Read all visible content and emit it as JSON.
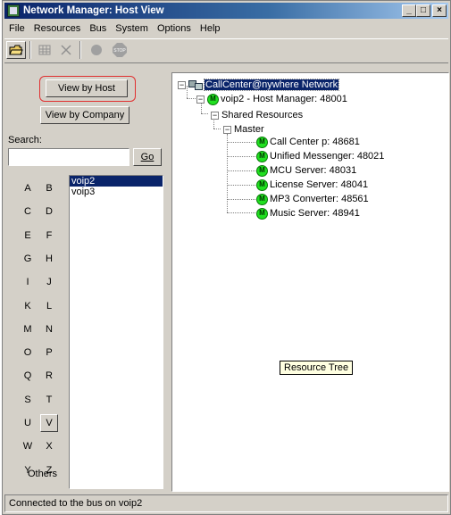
{
  "window": {
    "title": "Network Manager: Host View",
    "controls": {
      "minimize": "_",
      "maximize": "□",
      "close": "×"
    }
  },
  "menu": [
    "File",
    "Resources",
    "Bus",
    "System",
    "Options",
    "Help"
  ],
  "toolbar": {
    "icons": [
      "open-folder-icon",
      "grid-icon",
      "delete-x-icon",
      "record-icon",
      "stop-icon"
    ],
    "stop_label": "STOP"
  },
  "left": {
    "view_by_host": "View by Host",
    "view_by_company": "View by Company",
    "search_label": "Search:",
    "search_value": "",
    "go_label": "Go",
    "letters": [
      "A",
      "B",
      "C",
      "D",
      "E",
      "F",
      "G",
      "H",
      "I",
      "J",
      "K",
      "L",
      "M",
      "N",
      "O",
      "P",
      "Q",
      "R",
      "S",
      "T",
      "U",
      "V",
      "W",
      "X",
      "Y",
      "Z"
    ],
    "pressed_letter": "V",
    "others_label": "Others",
    "hosts": [
      "voip2",
      "voip3"
    ],
    "selected_host": "voip2"
  },
  "tree": {
    "root": {
      "expander": "−",
      "label": "CallCenter@nywhere Network"
    },
    "host": {
      "expander": "−",
      "label": "voip2 - Host Manager: 48001"
    },
    "shared": {
      "expander": "−",
      "label": "Shared Resources"
    },
    "master": {
      "expander": "−",
      "label": "Master"
    },
    "m_badge": "M",
    "resources": [
      "Call Center p: 48681",
      "Unified Messenger: 48021",
      "MCU Server: 48031",
      "License Server: 48041",
      "MP3 Converter: 48561",
      "Music Server: 48941"
    ],
    "tooltip": "Resource Tree"
  },
  "status": {
    "text": "Connected to the bus on voip2"
  }
}
